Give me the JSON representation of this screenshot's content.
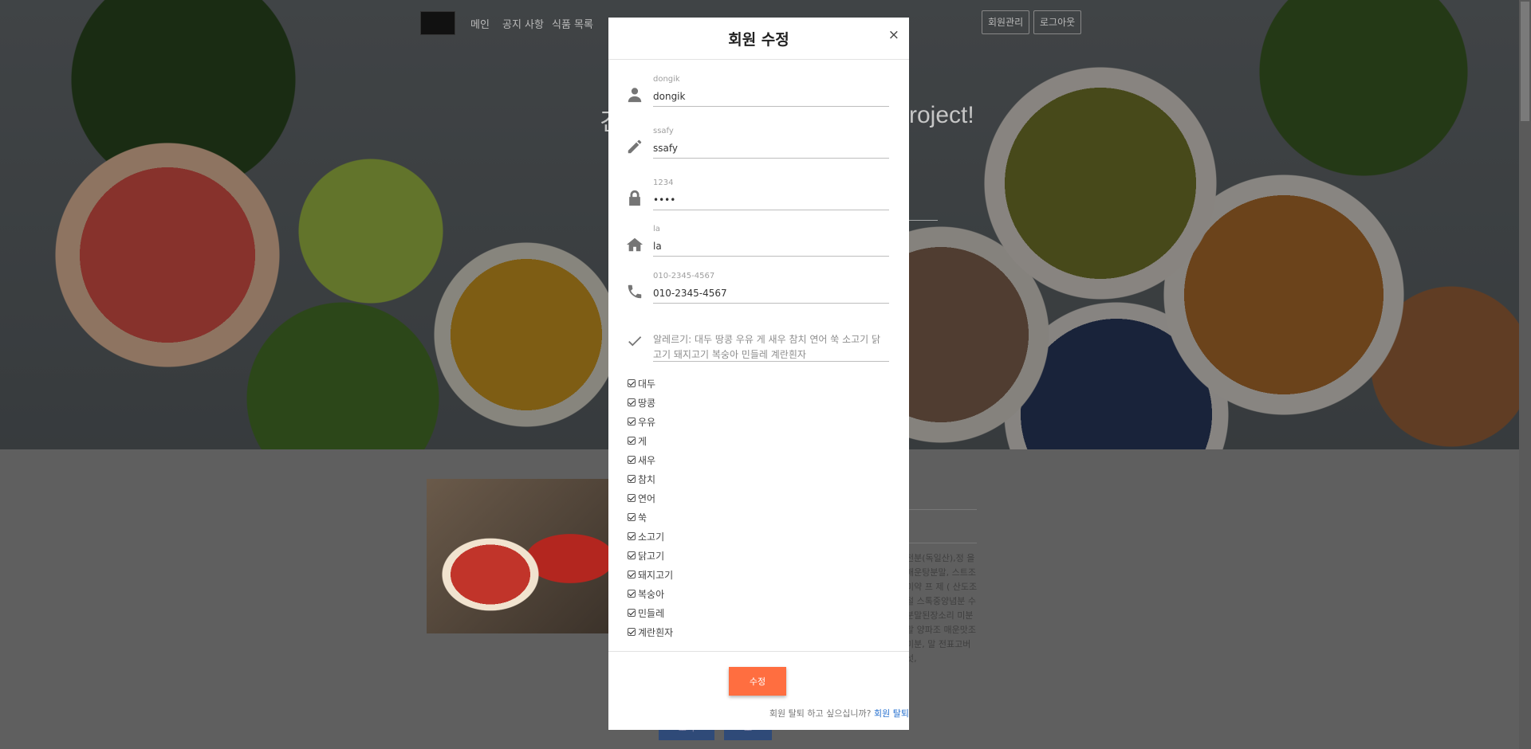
{
  "nav": {
    "items": [
      "메인",
      "공지 사항",
      "식품 목록"
    ],
    "member_manage": "회원관리",
    "logout": "로그아웃"
  },
  "hero": {
    "title_left": "건",
    "title_right": "roject!"
  },
  "modal": {
    "title": "회원 수정",
    "close": "×",
    "id": {
      "placeholder": "dongik",
      "value": "dongik"
    },
    "password": {
      "placeholder": "ssafy",
      "value": "ssafy"
    },
    "name": {
      "placeholder": "1234",
      "value": "••••"
    },
    "address": {
      "placeholder": "la",
      "value": "la"
    },
    "phone": {
      "placeholder": "010-2345-4567",
      "value": "010-2345-4567"
    },
    "allergy_text": "알레르기: 대두 땅콩 우유 게 새우 참치 연어 쑥 소고기 닭고기 돼지고기 복숭아 민들레 계란흰자",
    "allergies": [
      "대두",
      "땅콩",
      "우유",
      "게",
      "새우",
      "참치",
      "연어",
      "쑥",
      "소고기",
      "닭고기",
      "돼지고기",
      "복숭아",
      "민들레",
      "계란흰자"
    ],
    "submit": "수정",
    "withdraw_prompt": "회원 탈퇴 하고 싶으십니까?",
    "withdraw_link": "회원 탈퇴"
  },
  "content": {
    "side_text": "전분(독일산),정 을 매운탕분말, 스트조미약 프 제 ( 산도조절 스톡중양념분 수 분말된장소리 미분말 양파조 매운맛조미분, 말 전표고버섯,",
    "btn1": "보기",
    "btn2": "보"
  },
  "colors": {
    "accent": "#ff6e40",
    "link": "#2a73d0"
  }
}
